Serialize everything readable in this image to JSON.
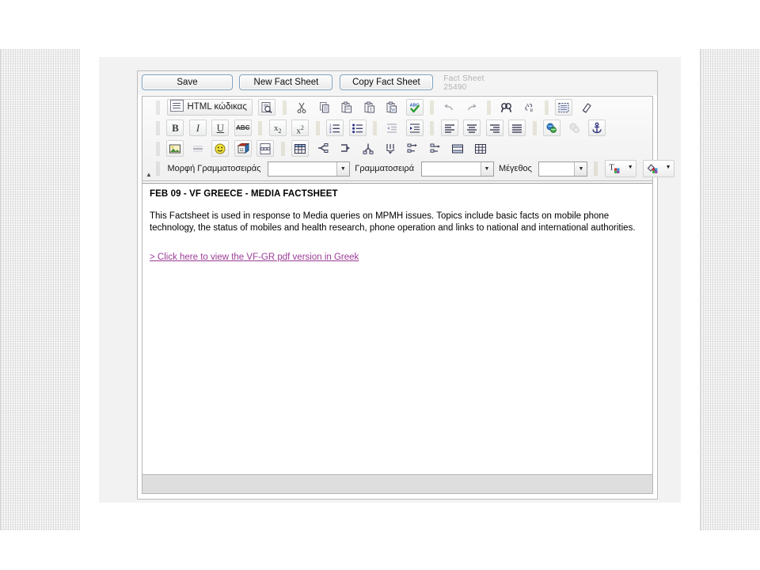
{
  "window": {
    "record_type": "Fact Sheet",
    "record_id": "25490"
  },
  "actions": {
    "save": "Save",
    "new_fact_sheet": "New Fact Sheet",
    "copy_fact_sheet": "Copy Fact Sheet"
  },
  "toolbar": {
    "collapse_glyph": "▲",
    "source_label": "HTML κώδικας",
    "row1": [
      {
        "name": "preview-button",
        "title": "Preview"
      },
      {
        "name": "cut-button",
        "title": "Cut"
      },
      {
        "name": "copy-button",
        "title": "Copy"
      },
      {
        "name": "paste-button",
        "title": "Paste"
      },
      {
        "name": "paste-text-button",
        "title": "Paste as plain text"
      },
      {
        "name": "paste-word-button",
        "title": "Paste from Word"
      },
      {
        "name": "spellcheck-button",
        "title": "Check spelling"
      },
      {
        "name": "undo-button",
        "title": "Undo"
      },
      {
        "name": "redo-button",
        "title": "Redo"
      },
      {
        "name": "find-button",
        "title": "Find"
      },
      {
        "name": "replace-button",
        "title": "Replace"
      },
      {
        "name": "select-all-button",
        "title": "Select All"
      },
      {
        "name": "remove-format-button",
        "title": "Remove Format"
      }
    ],
    "row2": [
      {
        "name": "bold-button",
        "label": "B"
      },
      {
        "name": "italic-button",
        "label": "I"
      },
      {
        "name": "underline-button",
        "label": "U"
      },
      {
        "name": "strikethrough-button",
        "label": "ABC"
      },
      {
        "name": "subscript-button",
        "label": "x₂"
      },
      {
        "name": "superscript-button",
        "label": "x²"
      },
      {
        "name": "numbered-list-button",
        "title": "Insert/Remove Numbered List"
      },
      {
        "name": "bulleted-list-button",
        "title": "Insert/Remove Bulleted List"
      },
      {
        "name": "outdent-button",
        "title": "Decrease Indent"
      },
      {
        "name": "indent-button",
        "title": "Increase Indent"
      },
      {
        "name": "align-left-button",
        "title": "Align Left"
      },
      {
        "name": "align-center-button",
        "title": "Center"
      },
      {
        "name": "align-right-button",
        "title": "Align Right"
      },
      {
        "name": "align-justify-button",
        "title": "Justify"
      },
      {
        "name": "link-button",
        "title": "Insert/Edit Link"
      },
      {
        "name": "unlink-button",
        "title": "Unlink"
      },
      {
        "name": "anchor-button",
        "title": "Insert/Edit Anchor"
      }
    ],
    "row3": [
      {
        "name": "image-button",
        "title": "Insert/Edit Image"
      },
      {
        "name": "horizontal-rule-button",
        "title": "Insert Horizontal Line"
      },
      {
        "name": "smiley-button",
        "title": "Insert Smiley"
      },
      {
        "name": "special-char-button",
        "title": "Insert Special Character"
      },
      {
        "name": "page-break-button",
        "title": "Insert Page Break"
      },
      {
        "name": "table-button",
        "title": "Insert/Edit Table"
      },
      {
        "name": "cell-properties-button",
        "title": "Cell Properties"
      },
      {
        "name": "merge-cells-button",
        "title": "Merge Cells"
      },
      {
        "name": "split-cell-button",
        "title": "Split Cell"
      },
      {
        "name": "delete-row-button",
        "title": "Delete Row"
      },
      {
        "name": "insert-row-button",
        "title": "Insert Row"
      },
      {
        "name": "insert-column-button",
        "title": "Insert Column"
      },
      {
        "name": "row-properties-button",
        "title": "Row Properties"
      },
      {
        "name": "table-properties-button",
        "title": "Table Properties"
      }
    ],
    "row4": {
      "format_label": "Μορφή Γραμματοσειράς",
      "format_value": "",
      "font_label": "Γραμματοσειρά",
      "font_value": "",
      "size_label": "Μέγεθος",
      "size_value": "",
      "arrow_glyph": "▼",
      "text_color_title": "Text Color",
      "bg_color_title": "Background Color"
    }
  },
  "document": {
    "heading": "FEB 09 - VF GREECE - MEDIA FACTSHEET",
    "paragraph": "This Factsheet is used in response to Media queries on MPMH issues. Topics include basic facts on mobile phone technology, the status of mobiles and health research, phone operation and links to national and international authorities.",
    "link_text": "> Click here to view the VF-GR pdf version in Greek",
    "link_color": "#9b3b96"
  },
  "colors": {
    "shell_bg": "#f2f2f2",
    "toolbar_bg": "#f3f3f3",
    "button_border": "#7ea0c0",
    "statusbar": "#dedede",
    "record_label": "#b3b3b3"
  }
}
